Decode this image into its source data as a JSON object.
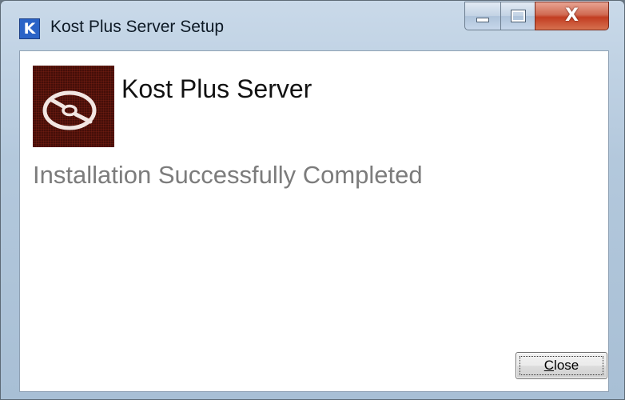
{
  "window": {
    "title": "Kost Plus Server Setup",
    "icon_letter": "K",
    "icon": "app-k-icon"
  },
  "caption_buttons": {
    "minimize_icon": "minimize-icon",
    "maximize_icon": "maximize-icon",
    "close_glyph": "X",
    "close_icon": "close-icon"
  },
  "content": {
    "product_name": "Kost Plus Server",
    "product_icon": "disc-icon",
    "status": "Installation Successfully Completed"
  },
  "buttons": {
    "close_mnemonic": "C",
    "close_rest": "lose"
  },
  "colors": {
    "close_caption": "#c23d22",
    "logo_background": "#3a0b06",
    "status_text": "#7c7c7c"
  }
}
